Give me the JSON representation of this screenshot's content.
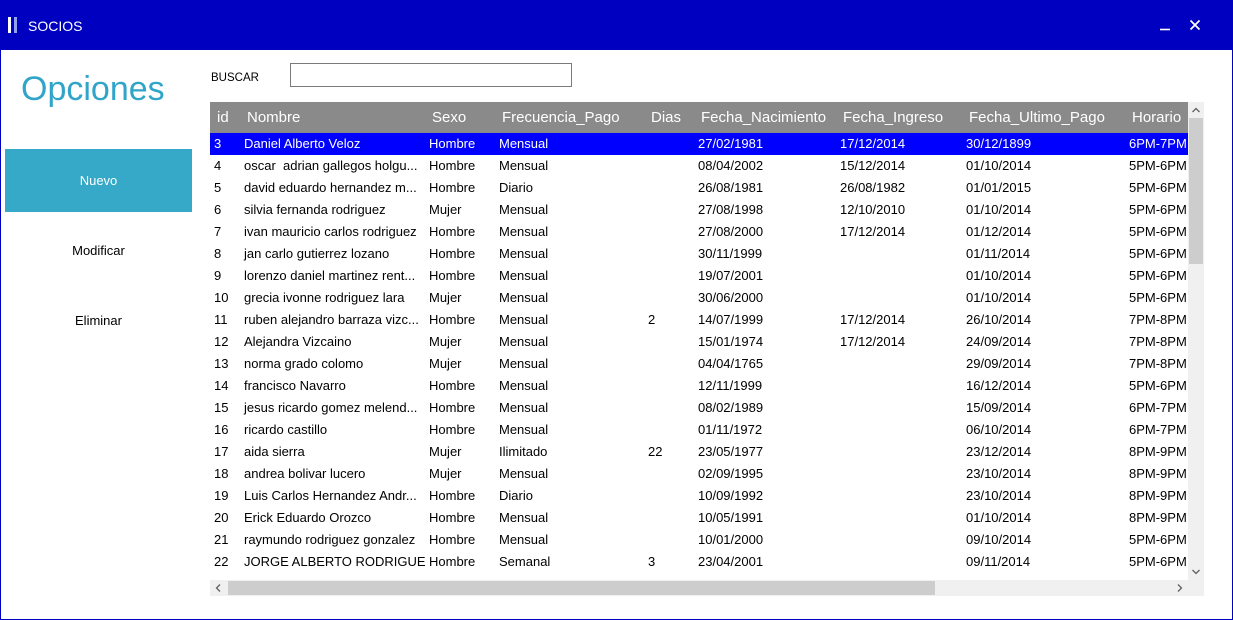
{
  "window": {
    "title": "SOCIOS",
    "icons": {
      "app": "app-icon",
      "minimize": "minimize-icon",
      "close": "close-icon"
    }
  },
  "sidebar": {
    "title": "Opciones",
    "items": [
      {
        "label": "Nuevo",
        "active": true
      },
      {
        "label": "Modificar",
        "active": false
      },
      {
        "label": "Eliminar",
        "active": false
      }
    ]
  },
  "search": {
    "label": "BUSCAR",
    "value": ""
  },
  "table": {
    "columns": [
      "id",
      "Nombre",
      "Sexo",
      "Frecuencia_Pago",
      "Dias",
      "Fecha_Nacimiento",
      "Fecha_Ingreso",
      "Fecha_Ultimo_Pago",
      "Horario"
    ],
    "selected_index": 0,
    "rows": [
      [
        "3",
        "Daniel Alberto Veloz",
        "Hombre",
        "Mensual",
        "",
        "27/02/1981",
        "17/12/2014",
        "30/12/1899",
        "6PM-7PM"
      ],
      [
        "4",
        "oscar  adrian gallegos holgu...",
        "Hombre",
        "Mensual",
        "",
        "08/04/2002",
        "15/12/2014",
        "01/10/2014",
        "5PM-6PM"
      ],
      [
        "5",
        "david eduardo hernandez m...",
        "Hombre",
        "Diario",
        "",
        "26/08/1981",
        "26/08/1982",
        "01/01/2015",
        "5PM-6PM"
      ],
      [
        "6",
        "silvia fernanda rodriguez",
        "Mujer",
        "Mensual",
        "",
        "27/08/1998",
        "12/10/2010",
        "01/10/2014",
        "5PM-6PM"
      ],
      [
        "7",
        "ivan mauricio carlos rodriguez",
        "Hombre",
        "Mensual",
        "",
        "27/08/2000",
        "17/12/2014",
        "01/12/2014",
        "5PM-6PM"
      ],
      [
        "8",
        "jan carlo gutierrez lozano",
        "Hombre",
        "Mensual",
        "",
        "30/11/1999",
        "",
        "01/11/2014",
        "5PM-6PM"
      ],
      [
        "9",
        "lorenzo daniel martinez rent...",
        "Hombre",
        "Mensual",
        "",
        "19/07/2001",
        "",
        "01/10/2014",
        "5PM-6PM"
      ],
      [
        "10",
        "grecia ivonne rodriguez lara",
        "Mujer",
        "Mensual",
        "",
        "30/06/2000",
        "",
        "01/10/2014",
        "5PM-6PM"
      ],
      [
        "11",
        "ruben alejandro barraza vizc...",
        "Hombre",
        "Mensual",
        "2",
        "14/07/1999",
        "17/12/2014",
        "26/10/2014",
        "7PM-8PM"
      ],
      [
        "12",
        "Alejandra Vizcaino",
        "Mujer",
        "Mensual",
        "",
        "15/01/1974",
        "17/12/2014",
        "24/09/2014",
        "7PM-8PM"
      ],
      [
        "13",
        "norma grado colomo",
        "Mujer",
        "Mensual",
        "",
        "04/04/1765",
        "",
        "29/09/2014",
        "7PM-8PM"
      ],
      [
        "14",
        "francisco Navarro",
        "Hombre",
        "Mensual",
        "",
        "12/11/1999",
        "",
        "16/12/2014",
        "5PM-6PM"
      ],
      [
        "15",
        "jesus ricardo gomez melend...",
        "Hombre",
        "Mensual",
        "",
        "08/02/1989",
        "",
        "15/09/2014",
        "6PM-7PM"
      ],
      [
        "16",
        "ricardo castillo",
        "Hombre",
        "Mensual",
        "",
        "01/11/1972",
        "",
        "06/10/2014",
        "6PM-7PM"
      ],
      [
        "17",
        "aida sierra",
        "Mujer",
        "Ilimitado",
        "22",
        "23/05/1977",
        "",
        "23/12/2014",
        "8PM-9PM"
      ],
      [
        "18",
        "andrea bolivar lucero",
        "Mujer",
        "Mensual",
        "",
        "02/09/1995",
        "",
        "23/10/2014",
        "8PM-9PM"
      ],
      [
        "19",
        "Luis Carlos Hernandez Andr...",
        "Hombre",
        "Diario",
        "",
        "10/09/1992",
        "",
        "23/10/2014",
        "8PM-9PM"
      ],
      [
        "20",
        "Erick Eduardo Orozco",
        "Hombre",
        "Mensual",
        "",
        "10/05/1991",
        "",
        "01/10/2014",
        "8PM-9PM"
      ],
      [
        "21",
        "raymundo rodriguez gonzalez",
        "Hombre",
        "Mensual",
        "",
        "10/01/2000",
        "",
        "09/10/2014",
        "5PM-6PM"
      ],
      [
        "22",
        "JORGE ALBERTO RODRIGUE...",
        "Hombre",
        "Semanal",
        "3",
        "23/04/2001",
        "",
        "09/11/2014",
        "5PM-6PM"
      ]
    ]
  },
  "scrollbars": {
    "icons": {
      "up": "chevron-up-icon",
      "down": "chevron-down-icon",
      "left": "chevron-left-icon",
      "right": "chevron-right-icon"
    }
  },
  "colors": {
    "titlebar": "#0000c0",
    "accent": "#36a9c9",
    "sidebar_title": "#30a4c9",
    "header_bg": "#8a8a8a",
    "selection": "#0000ff"
  }
}
